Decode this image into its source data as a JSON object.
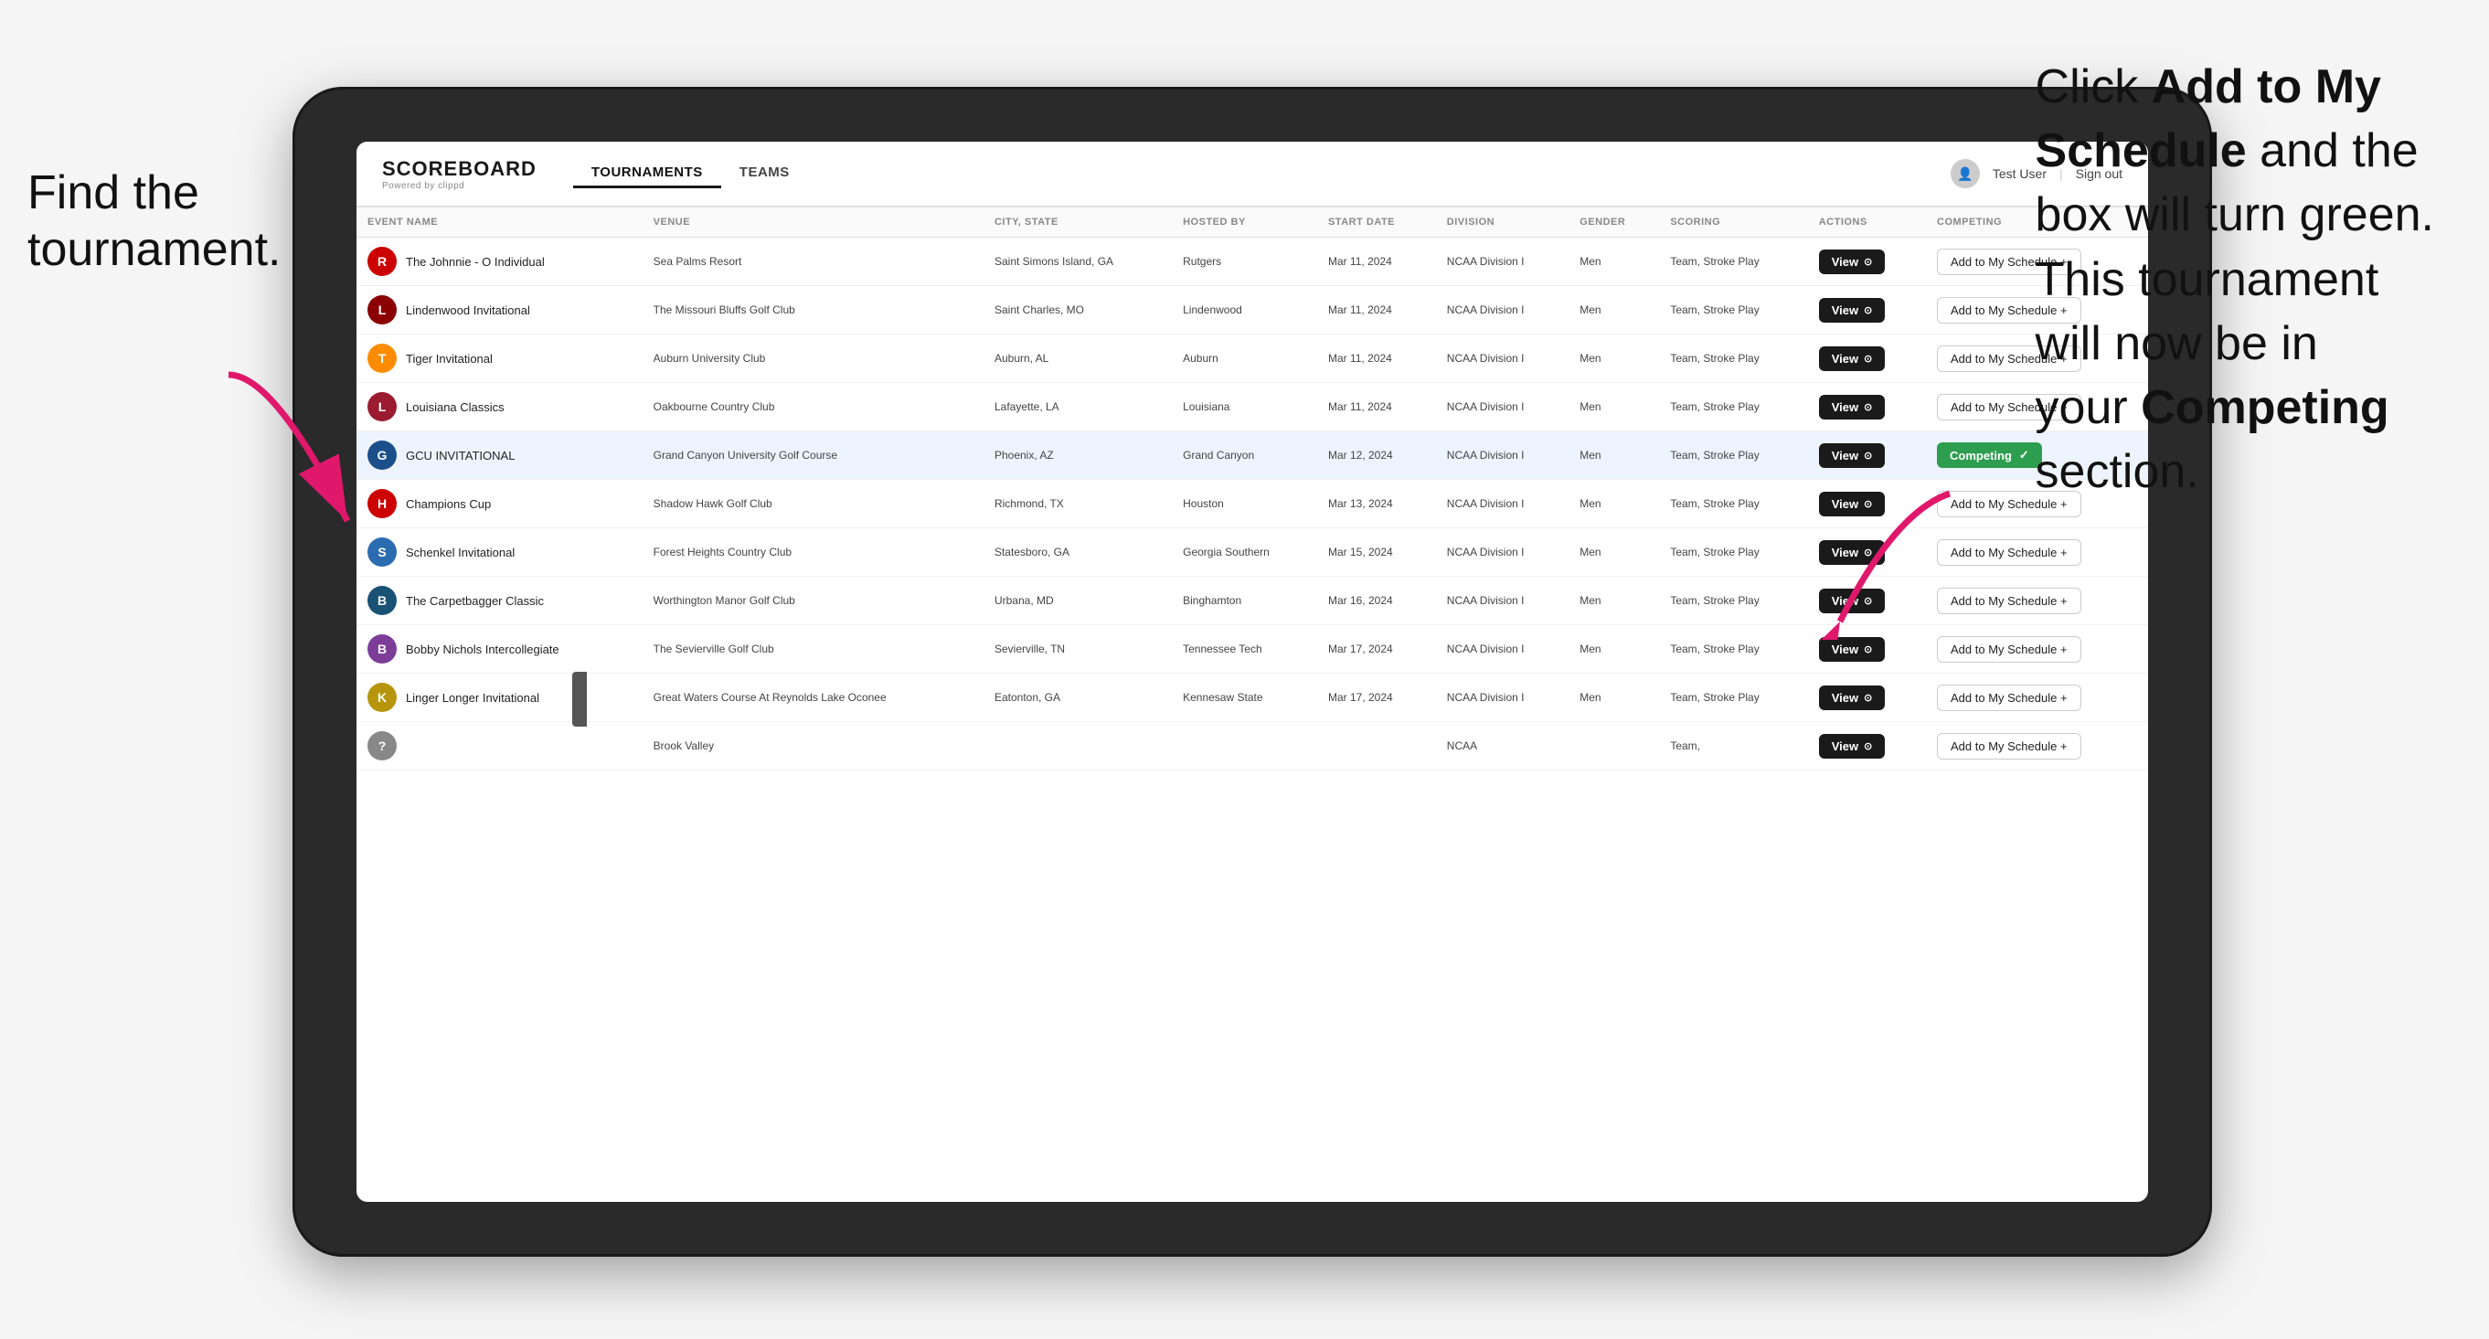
{
  "annotations": {
    "left": "Find the\ntournament.",
    "right_part1": "Click ",
    "right_bold1": "Add to My\nSchedule",
    "right_part2": " and the\nbox will turn green.\nThis tournament\nwill now be in\nyour ",
    "right_bold2": "Competing",
    "right_part3": "\nsection."
  },
  "nav": {
    "logo": "SCOREBOARD",
    "logo_sub": "Powered by clippd",
    "links": [
      "TOURNAMENTS",
      "TEAMS"
    ],
    "active_link": "TOURNAMENTS",
    "user": "Test User",
    "sign_out": "Sign out"
  },
  "table": {
    "headers": [
      "EVENT NAME",
      "VENUE",
      "CITY, STATE",
      "HOSTED BY",
      "START DATE",
      "DIVISION",
      "GENDER",
      "SCORING",
      "ACTIONS",
      "COMPETING"
    ],
    "rows": [
      {
        "logo_text": "R",
        "logo_bg": "#cc0000",
        "logo_color": "#fff",
        "event": "The Johnnie - O Individual",
        "venue": "Sea Palms Resort",
        "city_state": "Saint Simons Island, GA",
        "hosted_by": "Rutgers",
        "start_date": "Mar 11, 2024",
        "division": "NCAA Division I",
        "gender": "Men",
        "scoring": "Team, Stroke Play",
        "action": "View",
        "competing_type": "add",
        "competing_label": "Add to My Schedule +"
      },
      {
        "logo_text": "L",
        "logo_bg": "#8B0000",
        "logo_color": "#fff",
        "event": "Lindenwood Invitational",
        "venue": "The Missouri Bluffs Golf Club",
        "city_state": "Saint Charles, MO",
        "hosted_by": "Lindenwood",
        "start_date": "Mar 11, 2024",
        "division": "NCAA Division I",
        "gender": "Men",
        "scoring": "Team, Stroke Play",
        "action": "View",
        "competing_type": "add",
        "competing_label": "Add to My Schedule +"
      },
      {
        "logo_text": "T",
        "logo_bg": "#FF8C00",
        "logo_color": "#fff",
        "event": "Tiger Invitational",
        "venue": "Auburn University Club",
        "city_state": "Auburn, AL",
        "hosted_by": "Auburn",
        "start_date": "Mar 11, 2024",
        "division": "NCAA Division I",
        "gender": "Men",
        "scoring": "Team, Stroke Play",
        "action": "View",
        "competing_type": "add",
        "competing_label": "Add to My Schedule +"
      },
      {
        "logo_text": "L",
        "logo_bg": "#9B1B30",
        "logo_color": "#fff",
        "event": "Louisiana Classics",
        "venue": "Oakbourne Country Club",
        "city_state": "Lafayette, LA",
        "hosted_by": "Louisiana",
        "start_date": "Mar 11, 2024",
        "division": "NCAA Division I",
        "gender": "Men",
        "scoring": "Team, Stroke Play",
        "action": "View",
        "competing_type": "add",
        "competing_label": "Add to My Schedule +"
      },
      {
        "logo_text": "G",
        "logo_bg": "#1B4F8A",
        "logo_color": "#fff",
        "event": "GCU INVITATIONAL",
        "venue": "Grand Canyon University Golf Course",
        "city_state": "Phoenix, AZ",
        "hosted_by": "Grand Canyon",
        "start_date": "Mar 12, 2024",
        "division": "NCAA Division I",
        "gender": "Men",
        "scoring": "Team, Stroke Play",
        "action": "View",
        "competing_type": "competing",
        "competing_label": "Competing ✓",
        "highlighted": true
      },
      {
        "logo_text": "H",
        "logo_bg": "#CC0000",
        "logo_color": "#fff",
        "event": "Champions Cup",
        "venue": "Shadow Hawk Golf Club",
        "city_state": "Richmond, TX",
        "hosted_by": "Houston",
        "start_date": "Mar 13, 2024",
        "division": "NCAA Division I",
        "gender": "Men",
        "scoring": "Team, Stroke Play",
        "action": "View",
        "competing_type": "add",
        "competing_label": "Add to My Schedule +"
      },
      {
        "logo_text": "S",
        "logo_bg": "#2B6CB0",
        "logo_color": "#fff",
        "event": "Schenkel Invitational",
        "venue": "Forest Heights Country Club",
        "city_state": "Statesboro, GA",
        "hosted_by": "Georgia Southern",
        "start_date": "Mar 15, 2024",
        "division": "NCAA Division I",
        "gender": "Men",
        "scoring": "Team, Stroke Play",
        "action": "View",
        "competing_type": "add",
        "competing_label": "Add to My Schedule +"
      },
      {
        "logo_text": "B",
        "logo_bg": "#1a5276",
        "logo_color": "#fff",
        "event": "The Carpetbagger Classic",
        "venue": "Worthington Manor Golf Club",
        "city_state": "Urbana, MD",
        "hosted_by": "Binghamton",
        "start_date": "Mar 16, 2024",
        "division": "NCAA Division I",
        "gender": "Men",
        "scoring": "Team, Stroke Play",
        "action": "View",
        "competing_type": "add",
        "competing_label": "Add to My Schedule +"
      },
      {
        "logo_text": "B",
        "logo_bg": "#7D3C98",
        "logo_color": "#fff",
        "event": "Bobby Nichols Intercollegiate",
        "venue": "The Sevierville Golf Club",
        "city_state": "Sevierville, TN",
        "hosted_by": "Tennessee Tech",
        "start_date": "Mar 17, 2024",
        "division": "NCAA Division I",
        "gender": "Men",
        "scoring": "Team, Stroke Play",
        "action": "View",
        "competing_type": "add",
        "competing_label": "Add to My Schedule +"
      },
      {
        "logo_text": "K",
        "logo_bg": "#B7950B",
        "logo_color": "#fff",
        "event": "Linger Longer Invitational",
        "venue": "Great Waters Course At Reynolds Lake Oconee",
        "city_state": "Eatonton, GA",
        "hosted_by": "Kennesaw State",
        "start_date": "Mar 17, 2024",
        "division": "NCAA Division I",
        "gender": "Men",
        "scoring": "Team, Stroke Play",
        "action": "View",
        "competing_type": "add",
        "competing_label": "Add to My Schedule +"
      },
      {
        "logo_text": "?",
        "logo_bg": "#888",
        "logo_color": "#fff",
        "event": "",
        "venue": "Brook Valley",
        "city_state": "",
        "hosted_by": "",
        "start_date": "",
        "division": "NCAA",
        "gender": "",
        "scoring": "Team,",
        "action": "View",
        "competing_type": "add",
        "competing_label": "Add to My Schedule +"
      }
    ]
  }
}
